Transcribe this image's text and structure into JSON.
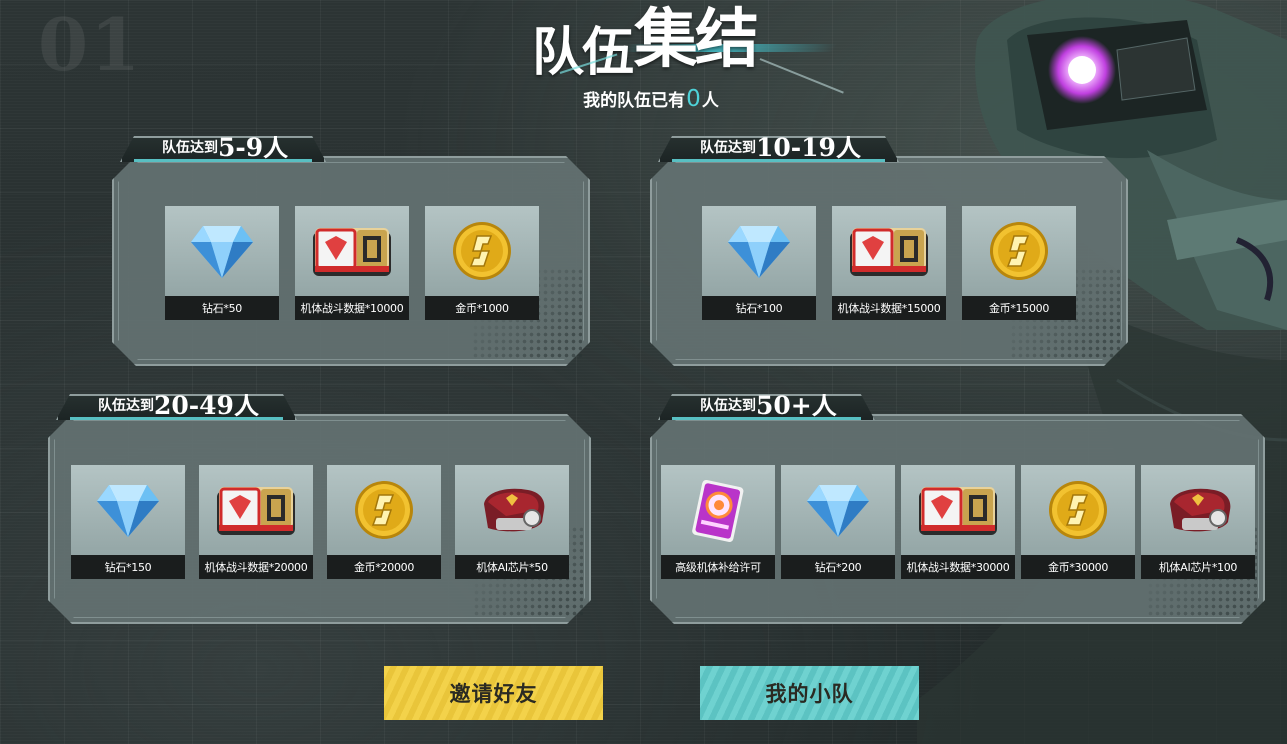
{
  "background": {
    "deco_number": "01"
  },
  "header": {
    "title_part1": "队伍",
    "title_part2": "集结",
    "team_prefix": "我的队伍已有",
    "team_count": "0",
    "team_suffix": "人",
    "accent_color": "#4ed2d8"
  },
  "tiers": [
    {
      "label_prefix": "队伍达到",
      "label_range": "5-9人",
      "rewards": [
        {
          "icon": "diamond-icon",
          "label": "钻石*50"
        },
        {
          "icon": "battle-data-icon",
          "label": "机体战斗数据*10000"
        },
        {
          "icon": "gold-coin-icon",
          "label": "金币*1000"
        }
      ]
    },
    {
      "label_prefix": "队伍达到",
      "label_range": "10-19人",
      "rewards": [
        {
          "icon": "diamond-icon",
          "label": "钻石*100"
        },
        {
          "icon": "battle-data-icon",
          "label": "机体战斗数据*15000"
        },
        {
          "icon": "gold-coin-icon",
          "label": "金币*15000"
        }
      ]
    },
    {
      "label_prefix": "队伍达到",
      "label_range": "20-49人",
      "rewards": [
        {
          "icon": "diamond-icon",
          "label": "钻石*150"
        },
        {
          "icon": "battle-data-icon",
          "label": "机体战斗数据*20000"
        },
        {
          "icon": "gold-coin-icon",
          "label": "金币*20000"
        },
        {
          "icon": "ai-chip-icon",
          "label": "机体AI芯片*50"
        }
      ]
    },
    {
      "label_prefix": "队伍达到",
      "label_range": "50+人",
      "rewards": [
        {
          "icon": "supply-permit-card-icon",
          "label": "高级机体补给许可"
        },
        {
          "icon": "diamond-icon",
          "label": "钻石*200"
        },
        {
          "icon": "battle-data-icon",
          "label": "机体战斗数据*30000"
        },
        {
          "icon": "gold-coin-icon",
          "label": "金币*30000"
        },
        {
          "icon": "ai-chip-icon",
          "label": "机体AI芯片*100"
        }
      ]
    }
  ],
  "buttons": {
    "invite_label": "邀请好友",
    "my_team_label": "我的小队",
    "invite_color": "#f3d24a",
    "my_team_color": "#6fd2d0"
  }
}
